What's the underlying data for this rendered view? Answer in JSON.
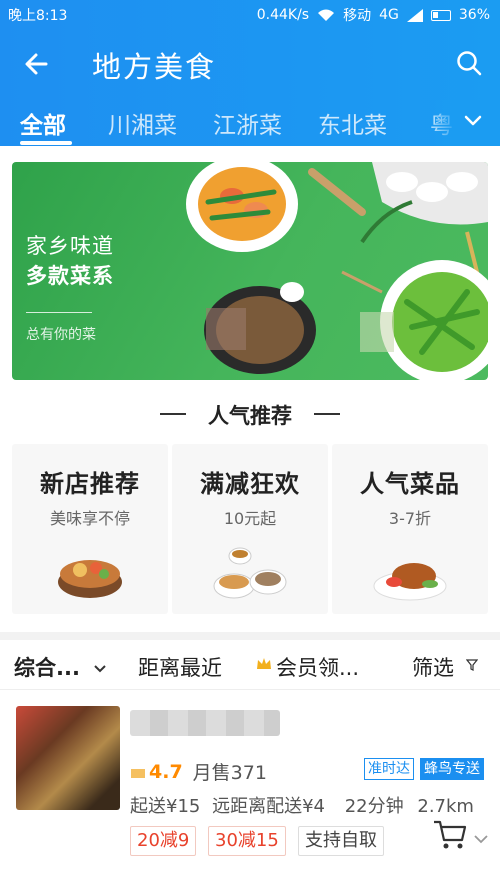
{
  "status_bar": {
    "time": "晚上8:13",
    "speed": "0.44K/s",
    "carrier": "移动",
    "network": "4G",
    "battery": "36%"
  },
  "header": {
    "title": "地方美食"
  },
  "tabs": [
    {
      "label": "全部",
      "active": true
    },
    {
      "label": "川湘菜",
      "active": false
    },
    {
      "label": "江浙菜",
      "active": false
    },
    {
      "label": "东北菜",
      "active": false
    },
    {
      "label": "粤",
      "active": false
    }
  ],
  "banner": {
    "line1": "家乡味道",
    "line2": "多款菜系",
    "line3": "总有你的菜"
  },
  "section": {
    "title": "人气推荐"
  },
  "promos": [
    {
      "title": "新店推荐",
      "subtitle": "美味享不停"
    },
    {
      "title": "满减狂欢",
      "subtitle": "10元起"
    },
    {
      "title": "人气菜品",
      "subtitle": "3-7折"
    }
  ],
  "filters": {
    "sort": "综合...",
    "distance": "距离最近",
    "member": "会员领...",
    "filter": "筛选"
  },
  "shop": {
    "rating": "4.7",
    "monthly_sales": "月售371",
    "tag_ontime": "准时达",
    "tag_delivery": "蜂鸟专送",
    "min_order": "起送¥15",
    "delivery_fee": "远距离配送¥4",
    "time": "22分钟",
    "distance": "2.7km",
    "discounts": [
      "20减9",
      "30减15"
    ],
    "pickup": "支持自取"
  },
  "colors": {
    "brand_blue": "#1b96f2",
    "banner_green": "#3fb257",
    "rating_orange": "#ff8a00",
    "discount_red": "#e8422c"
  }
}
